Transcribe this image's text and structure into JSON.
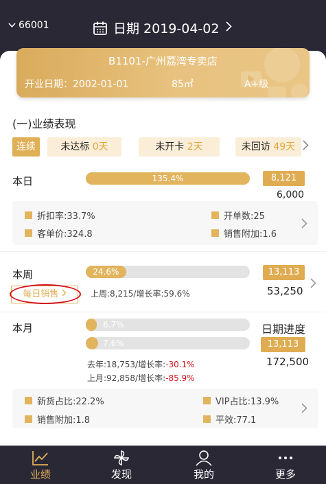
{
  "header": {
    "store_code": "66001",
    "date_label": "日期 2019-04-02"
  },
  "store_card": {
    "name": "B1101-广州荔湾专卖店",
    "open_date": "开业日期：2002-01-01",
    "area": "85㎡",
    "level": "A+级"
  },
  "performance": {
    "section_title": "(一)业绩表现",
    "streak_label": "连续",
    "chips": [
      {
        "label": "未达标",
        "value": "0天"
      },
      {
        "label": "未开卡",
        "value": "2天"
      },
      {
        "label": "未回访",
        "value": "49天"
      }
    ]
  },
  "today": {
    "label": "本日",
    "progress_text": "135.4%",
    "progress": 1.0,
    "actual": "8,121",
    "target": "6,000",
    "metrics": [
      {
        "label": "折扣率:33.7%"
      },
      {
        "label": "开单数:25"
      },
      {
        "label": "客单价:324.8"
      },
      {
        "label": "销售附加:1.6"
      }
    ]
  },
  "week": {
    "label": "本周",
    "progress_text": "24.6%",
    "progress": 0.246,
    "daily_sales_button": "每日销售",
    "last_week": "上周:8,215/增长率:59.6%",
    "actual": "13,113",
    "target": "53,250"
  },
  "month": {
    "label": "本月",
    "date_progress_label": "日期进度",
    "progress1_text": "6.7%",
    "progress1": 0.067,
    "progress2_text": "7.6%",
    "progress2": 0.076,
    "last_year_prefix": "去年:18,753/增长率:",
    "last_year_rate": "-30.1%",
    "last_month_prefix": "上月:92,858/增长率:",
    "last_month_rate": "-85.9%",
    "actual": "13,113",
    "target": "172,500",
    "metrics": [
      {
        "label": "新货占比:22.2%"
      },
      {
        "label": "VIP占比:13.9%"
      },
      {
        "label": "销售附加:1.8"
      },
      {
        "label": "平效:77.1"
      }
    ]
  },
  "tabs": [
    {
      "label": "业绩",
      "icon": "chart-line-icon",
      "active": true
    },
    {
      "label": "发现",
      "icon": "pinwheel-icon",
      "active": false
    },
    {
      "label": "我的",
      "icon": "user-icon",
      "active": false
    },
    {
      "label": "更多",
      "icon": "more-dots-icon",
      "active": false
    }
  ],
  "colors": {
    "accent": "#e0b057",
    "dark_bg": "#2b2836",
    "negative": "#d4141a"
  }
}
